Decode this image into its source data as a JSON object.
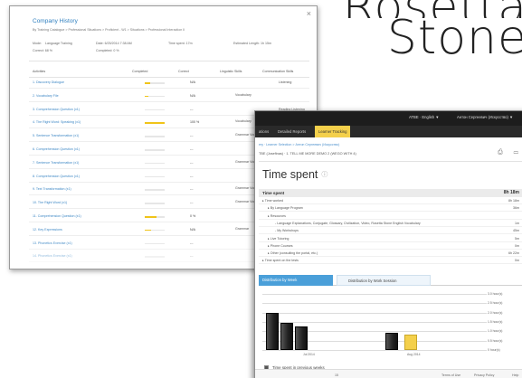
{
  "logo": {
    "line1": "Rosetta",
    "line2": "Stone"
  },
  "company_history": {
    "close_icon": "×",
    "title": "Company History",
    "breadcrumb": "By Training Catalogue > Professional Situations > Proficient - W1 > Situations > Professional Interaction II",
    "mode_label": "Mode:",
    "mode_value": "Language Training",
    "date": "Date: 6/25/2014 7:38 AM",
    "time_spent": "Time spent: 17m",
    "estimated_length": "Estimated Length: 1h 15m",
    "correct": "Correct: 68 %",
    "completed": "Completed: 0 %",
    "headers": [
      "Activities",
      "Completed",
      "Correct",
      "Linguistic Skills",
      "Communication Skills"
    ],
    "rows": [
      {
        "activity": "1. Discovery Dialogue",
        "completed": 0.25,
        "correct": "N/A",
        "skill": "",
        "comm": "Listening"
      },
      {
        "activity": "2. Vocabulary File",
        "completed": 0.2,
        "correct": "N/A",
        "skill": "Vocabulary",
        "comm": ""
      },
      {
        "activity": "3. Comprehension Question (x1)",
        "completed": 0,
        "correct": "---",
        "skill": "",
        "comm": "Reading Listening"
      },
      {
        "activity": "4. The Right Word: Speaking (x1)",
        "completed": 1.0,
        "correct": "100 %",
        "skill": "Vocabulary",
        "comm": "Speaking"
      },
      {
        "activity": "5. Sentence Transformation (x1)",
        "completed": 0,
        "correct": "---",
        "skill": "Grammar Vocabulary",
        "comm": "Writing"
      },
      {
        "activity": "6. Comprehension Question (x1)",
        "completed": 0,
        "correct": "---",
        "skill": "",
        "comm": ""
      },
      {
        "activity": "7. Sentence Transformation (x1)",
        "completed": 0,
        "correct": "---",
        "skill": "Grammar Vocabulary",
        "comm": ""
      },
      {
        "activity": "8. Comprehension Question (x1)",
        "completed": 0,
        "correct": "---",
        "skill": "",
        "comm": ""
      },
      {
        "activity": "9. Text Transformation (x1)",
        "completed": 0,
        "correct": "---",
        "skill": "Grammar Vocabulary",
        "comm": ""
      },
      {
        "activity": "10. The Right Word (x1)",
        "completed": 0,
        "correct": "---",
        "skill": "Grammar Vocabulary",
        "comm": ""
      },
      {
        "activity": "11. Comprehension Question (x1)",
        "completed": 0.6,
        "correct": "0 %",
        "skill": "",
        "comm": ""
      },
      {
        "activity": "12. Key Expressions",
        "completed": 0.3,
        "correct": "N/A",
        "skill": "Grammar",
        "comm": ""
      },
      {
        "activity": "13. Phonetics Exercise (x1)",
        "completed": 0,
        "correct": "---",
        "skill": "",
        "comm": ""
      },
      {
        "activity": "14. Phonetics Exercise (x1)",
        "completed": 0,
        "correct": "---",
        "skill": "",
        "comm": ""
      }
    ]
  },
  "time_spent_page": {
    "lang_menu": "ATBE · English ▼",
    "user_menu": "Антон Сергеевич (Искусство) ▼",
    "tabs": [
      "ations",
      "Detailed Reports",
      "Learner Tracking"
    ],
    "breadcrumb": "ery · Learner Selection > Антон Сергеевич (Искусство)",
    "course": "TBE (Josefinas) · 1. TELL ME MORE DEMO 2 (WEGO WITH 4)",
    "icons": "⎙ ▭",
    "title": "Time spent",
    "info_icon": "ⓘ",
    "summary_label": "Time spent",
    "summary_value": "8h 18m",
    "rows": [
      {
        "label": "▸ Time worked",
        "value": "8h 18m",
        "indent": 0
      },
      {
        "label": "▸ By Language Program",
        "value": "36m",
        "indent": 1
      },
      {
        "label": "▸ Resources",
        "value": "",
        "indent": 1
      },
      {
        "label": "- Language Explanations, Conjugate, Glossary, Civilization, Video, Rosetta Stone English Vocabulary",
        "value": "1m",
        "indent": 2
      },
      {
        "label": "- My Workshops",
        "value": "45m",
        "indent": 2
      },
      {
        "label": "▸ Live Tutoring",
        "value": "5m",
        "indent": 1
      },
      {
        "label": "▸ Phone Courses",
        "value": "0m",
        "indent": 1
      },
      {
        "label": "▸ Other (consulting the portal, etc.)",
        "value": "6h 22m",
        "indent": 1
      },
      {
        "label": "▸ Time spent on the tests",
        "value": "0m",
        "indent": 0
      }
    ],
    "dist_tabs": [
      "Distribution by Week",
      "Distribution by Work Session"
    ],
    "legend_previous": "Time spent in previous weeks",
    "legend_current": "Time spent this week: 49m",
    "footer": [
      "Terms of Use",
      "Privacy Policy",
      "Help"
    ],
    "page_marker": "15"
  },
  "chart_data": {
    "type": "bar",
    "ylabel": "hours",
    "ylim": [
      0,
      3
    ],
    "yticks": [
      "3.0 hour(s)",
      "2.5 hour(s)",
      "2.0 hour(s)",
      "1.5 hour(s)",
      "1.0 hour(s)",
      "0.5 hour(s)",
      "0 hour(s)"
    ],
    "x_labels": [
      "Jul 2014",
      "Aug 2014"
    ],
    "series": [
      {
        "name": "Time spent in previous weeks",
        "values": [
          2.0,
          1.45,
          1.25,
          0.9
        ],
        "color": "#222222"
      },
      {
        "name": "Time spent this week: 49m",
        "values": [
          0.82
        ],
        "color": "#f4d04b"
      }
    ],
    "grid": true
  }
}
